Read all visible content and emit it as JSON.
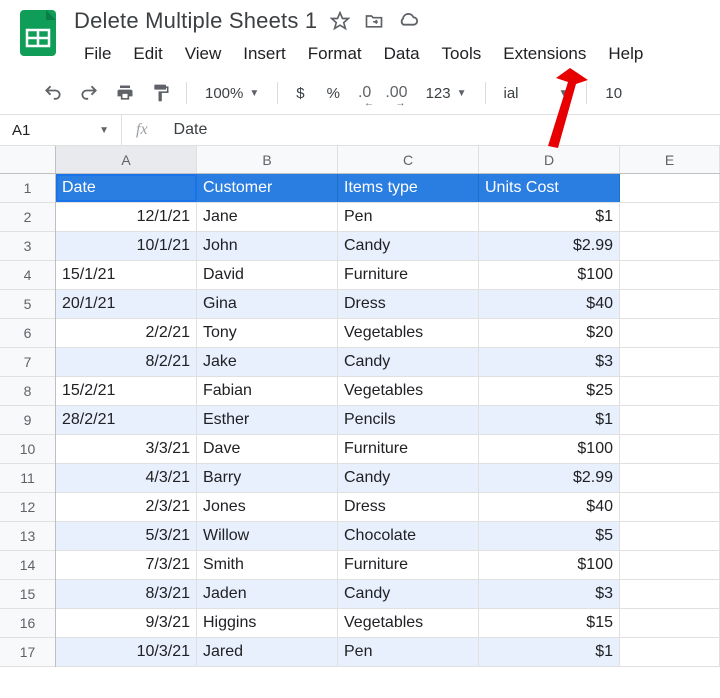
{
  "doc": {
    "title": "Delete Multiple Sheets 1"
  },
  "menu": {
    "file": "File",
    "edit": "Edit",
    "view": "View",
    "insert": "Insert",
    "format": "Format",
    "data": "Data",
    "tools": "Tools",
    "extensions": "Extensions",
    "help": "Help"
  },
  "toolbar": {
    "zoom": "100%",
    "currency": "$",
    "percent": "%",
    "dec_dec": ".0",
    "inc_dec": ".00",
    "numfmt": "123",
    "font": "ial",
    "fontsize": "10"
  },
  "namebox": {
    "ref": "A1",
    "value": "Date"
  },
  "columns": [
    "A",
    "B",
    "C",
    "D",
    "E"
  ],
  "headers": {
    "date": "Date",
    "customer": "Customer",
    "items": "Items type",
    "units": "Units Cost"
  },
  "rows": [
    {
      "n": "1"
    },
    {
      "n": "2",
      "date": "12/1/21",
      "date_align": "right",
      "customer": "Jane",
      "items": "Pen",
      "units": "$1"
    },
    {
      "n": "3",
      "date": "10/1/21",
      "date_align": "right",
      "customer": "John",
      "items": "Candy",
      "units": "$2.99"
    },
    {
      "n": "4",
      "date": "15/1/21",
      "date_align": "left",
      "customer": "David",
      "items": "Furniture",
      "units": "$100"
    },
    {
      "n": "5",
      "date": "20/1/21",
      "date_align": "left",
      "customer": "Gina",
      "items": "Dress",
      "units": "$40"
    },
    {
      "n": "6",
      "date": "2/2/21",
      "date_align": "right",
      "customer": "Tony",
      "items": "Vegetables",
      "units": "$20"
    },
    {
      "n": "7",
      "date": "8/2/21",
      "date_align": "right",
      "customer": "Jake",
      "items": "Candy",
      "units": "$3"
    },
    {
      "n": "8",
      "date": "15/2/21",
      "date_align": "left",
      "customer": "Fabian",
      "items": "Vegetables",
      "units": "$25"
    },
    {
      "n": "9",
      "date": "28/2/21",
      "date_align": "left",
      "customer": "Esther",
      "items": "Pencils",
      "units": "$1"
    },
    {
      "n": "10",
      "date": "3/3/21",
      "date_align": "right",
      "customer": "Dave",
      "items": "Furniture",
      "units": "$100"
    },
    {
      "n": "11",
      "date": "4/3/21",
      "date_align": "right",
      "customer": "Barry",
      "items": "Candy",
      "units": "$2.99"
    },
    {
      "n": "12",
      "date": "2/3/21",
      "date_align": "right",
      "customer": "Jones",
      "items": "Dress",
      "units": "$40"
    },
    {
      "n": "13",
      "date": "5/3/21",
      "date_align": "right",
      "customer": "Willow",
      "items": "Chocolate",
      "units": "$5"
    },
    {
      "n": "14",
      "date": "7/3/21",
      "date_align": "right",
      "customer": "Smith",
      "items": "Furniture",
      "units": "$100"
    },
    {
      "n": "15",
      "date": "8/3/21",
      "date_align": "right",
      "customer": "Jaden",
      "items": "Candy",
      "units": "$3"
    },
    {
      "n": "16",
      "date": "9/3/21",
      "date_align": "right",
      "customer": "Higgins",
      "items": "Vegetables",
      "units": "$15"
    },
    {
      "n": "17",
      "date": "10/3/21",
      "date_align": "right",
      "customer": "Jared",
      "items": "Pen",
      "units": "$1"
    }
  ]
}
